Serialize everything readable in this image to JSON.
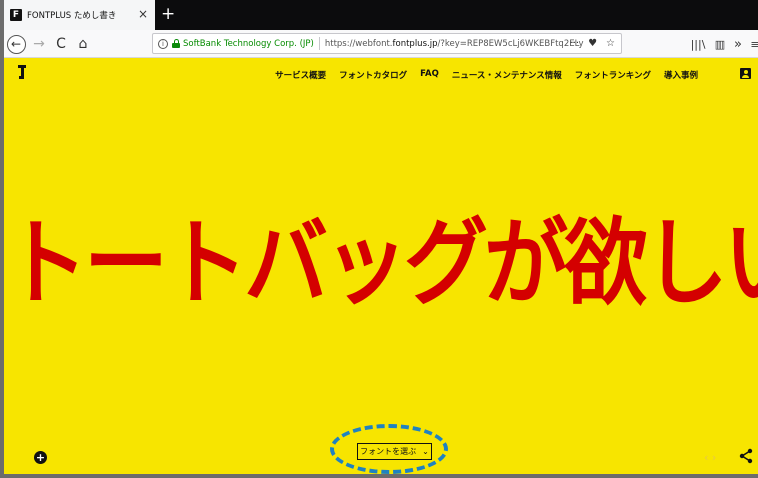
{
  "tab": {
    "title": "FONTPLUS ためし書き",
    "close": "×",
    "new_tab": "+"
  },
  "toolbar": {
    "back": "←",
    "forward": "→",
    "reload": "C",
    "home": "⌂",
    "library": "|||\\",
    "sidebar": "▥",
    "overflow": "»",
    "menu": "≡"
  },
  "urlbar": {
    "cert_owner": "SoftBank Technology Corp. (JP)",
    "url_prefix": "https://webfont.",
    "url_domain": "fontplus.jp",
    "url_suffix": "/?key=REP8EW5cLj6WKEBFtq2ELy",
    "more": "···",
    "pocket": "♥",
    "bookmark": "☆"
  },
  "site": {
    "logo": "FONTPLUS",
    "nav": [
      "サービス概要",
      "フォントカタログ",
      "FAQ",
      "ニュース・メンテナンス情報",
      "フォントランキング",
      "導入事例"
    ],
    "headline": "トートバッグが欲しい",
    "plus": "+",
    "font_select_label": "フォントを選ぶ",
    "font_select_chevron": "⌄",
    "code_toggle": "‹ ›"
  },
  "colors": {
    "page_bg": "#f7e500",
    "headline": "#d40000",
    "highlight_ring": "#1f82c0",
    "cert_green": "#058b00"
  },
  "icons": [
    "back-icon",
    "forward-icon",
    "reload-icon",
    "home-icon",
    "info-icon",
    "lock-icon",
    "more-icon",
    "pocket-icon",
    "bookmark-star-icon",
    "library-icon",
    "sidebar-icon",
    "overflow-icon",
    "menu-icon",
    "account-icon",
    "plus-icon",
    "code-icon",
    "share-icon"
  ]
}
